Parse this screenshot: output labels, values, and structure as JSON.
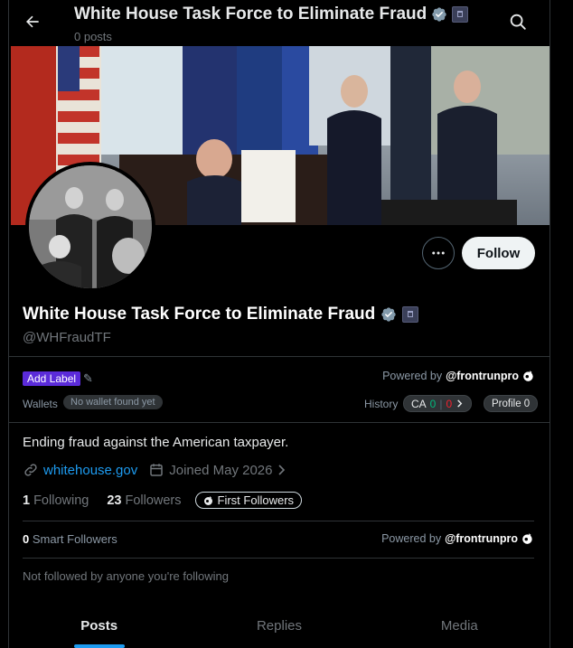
{
  "header": {
    "title": "White House Task Force to Eliminate Fraud",
    "post_count": "0 posts"
  },
  "profile": {
    "name": "White House Task Force to Eliminate Fraud",
    "handle": "@WHFraudTF",
    "follow_label": "Follow",
    "bio": "Ending fraud against the American taxpayer.",
    "website": "whitehouse.gov",
    "joined": "Joined May 2026",
    "following_count": "1",
    "following_label": "Following",
    "followers_count": "23",
    "followers_label": "Followers",
    "first_followers_label": "First Followers"
  },
  "extension": {
    "add_label": "Add Label",
    "powered_by_prefix": "Powered by",
    "powered_by_brand": "@frontrunpro",
    "wallets_label": "Wallets",
    "wallet_status": "No wallet found yet",
    "history_label": "History",
    "ca_label": "CA",
    "ca_green": "0",
    "ca_sep": "|",
    "ca_red": "0",
    "profile_label": "Profile 0",
    "smart_count": "0",
    "smart_label": "Smart Followers",
    "not_followed": "Not followed by anyone you're following"
  },
  "tabs": [
    {
      "label": "Posts",
      "active": true
    },
    {
      "label": "Replies",
      "active": false
    },
    {
      "label": "Media",
      "active": false
    }
  ],
  "colors": {
    "accent": "#1d9bf0",
    "label_purple": "#5b2bd9",
    "green": "#00ba7c",
    "red": "#f4212e",
    "verified_gray": "#829aab"
  },
  "icons": [
    "back-arrow-icon",
    "search-icon",
    "verified-icon",
    "gov-badge-icon",
    "more-dots-icon",
    "pencil-icon",
    "frontrun-logo-icon",
    "link-icon",
    "calendar-icon",
    "chevron-right-icon"
  ]
}
